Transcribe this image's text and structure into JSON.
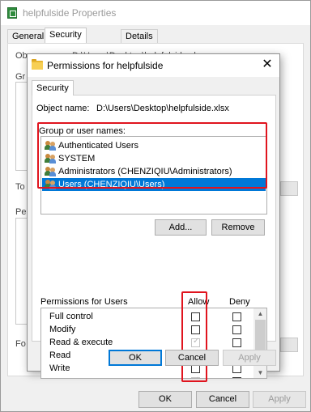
{
  "outer_window": {
    "title": "helpfulside Properties",
    "tabs": [
      "General",
      "Security",
      "Details"
    ],
    "object_label_partial": "Object name:",
    "object_value_partial": "D:\\Users\\Desktop\\helpfulside.xlsx",
    "group_label_partial": "Gr",
    "to_label_partial": "To",
    "perm_label_partial": "Pe",
    "for_label_partial": "Fo",
    "buttons": {
      "ok": "OK",
      "cancel": "Cancel",
      "apply": "Apply"
    }
  },
  "dialog": {
    "title": "Permissions for helpfulside",
    "close_glyph": "✕",
    "tab": "Security",
    "object_name_label": "Object name:",
    "object_name_value": "D:\\Users\\Desktop\\helpfulside.xlsx",
    "group_label": "Group or user names:",
    "users": [
      {
        "name": "Authenticated Users",
        "selected": false
      },
      {
        "name": "SYSTEM",
        "selected": false
      },
      {
        "name": "Administrators (CHENZIQIU\\Administrators)",
        "selected": false
      },
      {
        "name": "Users (CHENZIQIU\\Users)",
        "selected": true
      }
    ],
    "add_button": "Add...",
    "remove_button": "Remove",
    "permissions_label": "Permissions for Users",
    "allow_header": "Allow",
    "deny_header": "Deny",
    "permissions": [
      {
        "name": "Full control",
        "allow": false,
        "allow_inherited": false,
        "deny": false
      },
      {
        "name": "Modify",
        "allow": false,
        "allow_inherited": false,
        "deny": false
      },
      {
        "name": "Read & execute",
        "allow": true,
        "allow_inherited": true,
        "deny": false
      },
      {
        "name": "Read",
        "allow": true,
        "allow_inherited": true,
        "deny": false
      },
      {
        "name": "Write",
        "allow": false,
        "allow_inherited": false,
        "deny": false
      }
    ],
    "buttons": {
      "ok": "OK",
      "cancel": "Cancel",
      "apply": "Apply"
    }
  },
  "colors": {
    "highlight_red": "#e0141e",
    "selection_blue": "#0078d7"
  }
}
